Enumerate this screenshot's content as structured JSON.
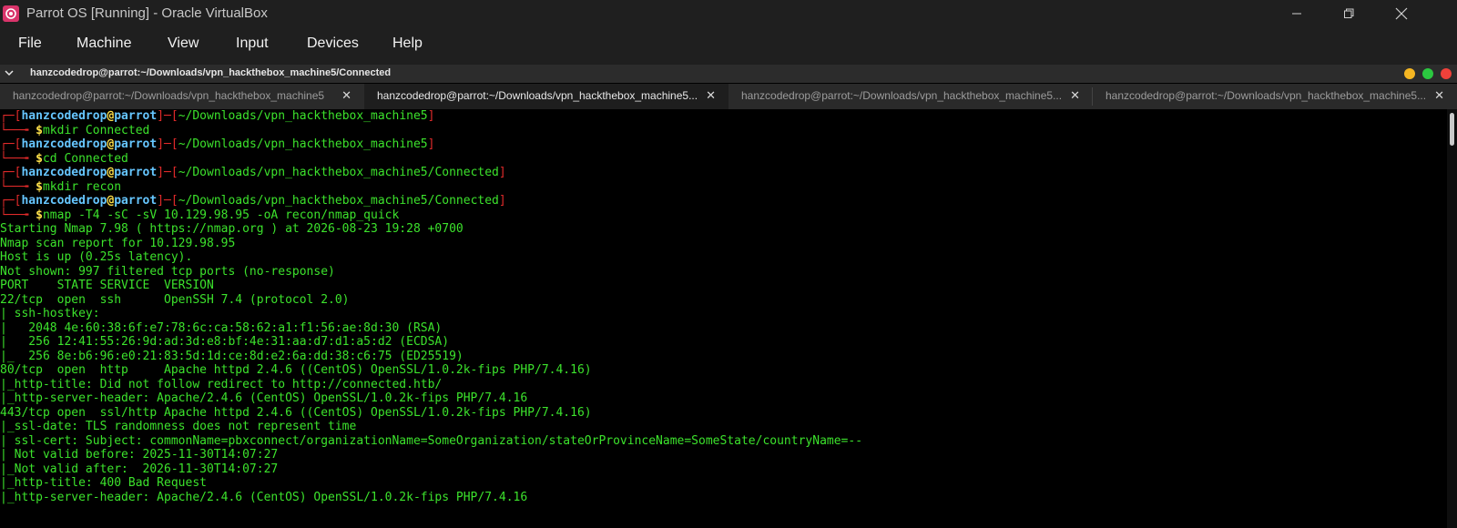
{
  "window": {
    "title": "Parrot OS [Running] - Oracle VirtualBox",
    "controls": [
      "minimize-icon",
      "restore-icon",
      "close-icon"
    ]
  },
  "menu": [
    "File",
    "Machine",
    "View",
    "Input",
    "Devices",
    "Help"
  ],
  "terminal_window": {
    "title": "hanzcodedrop@parrot:~/Downloads/vpn_hackthebox_machine5/Connected",
    "dot_colors": [
      "#f5b622",
      "#2bc840",
      "#f0413a"
    ]
  },
  "tabs": [
    {
      "label": "hanzcodedrop@parrot:~/Downloads/vpn_hackthebox_machine5",
      "active": false
    },
    {
      "label": "hanzcodedrop@parrot:~/Downloads/vpn_hackthebox_machine5...",
      "active": true
    },
    {
      "label": "hanzcodedrop@parrot:~/Downloads/vpn_hackthebox_machine5...",
      "active": false
    },
    {
      "label": "hanzcodedrop@parrot:~/Downloads/vpn_hackthebox_machine5...",
      "active": false
    }
  ],
  "prompt": {
    "user": "hanzcodedrop",
    "at": "@",
    "host": "parrot",
    "corner_top": "┌─[",
    "mid": "]─[",
    "close": "]",
    "corner_bottom": "└──╼ ",
    "dollar": "$"
  },
  "commands": [
    {
      "path": "~/Downloads/vpn_hackthebox_machine5",
      "cmd": "mkdir Connected"
    },
    {
      "path": "~/Downloads/vpn_hackthebox_machine5",
      "cmd": "cd Connected"
    },
    {
      "path": "~/Downloads/vpn_hackthebox_machine5/Connected",
      "cmd": "mkdir recon"
    },
    {
      "path": "~/Downloads/vpn_hackthebox_machine5/Connected",
      "cmd": "nmap -T4 -sC -sV 10.129.98.95 -oA recon/nmap_quick"
    }
  ],
  "output": [
    "Starting Nmap 7.98 ( https://nmap.org ) at 2026-08-23 19:28 +0700",
    "Nmap scan report for 10.129.98.95",
    "Host is up (0.25s latency).",
    "Not shown: 997 filtered tcp ports (no-response)",
    "PORT    STATE SERVICE  VERSION",
    "22/tcp  open  ssh      OpenSSH 7.4 (protocol 2.0)",
    "| ssh-hostkey:",
    "|   2048 4e:60:38:6f:e7:78:6c:ca:58:62:a1:f1:56:ae:8d:30 (RSA)",
    "|   256 12:41:55:26:9d:ad:3d:e8:bf:4e:31:aa:d7:d1:a5:d2 (ECDSA)",
    "|_  256 8e:b6:96:e0:21:83:5d:1d:ce:8d:e2:6a:dd:38:c6:75 (ED25519)",
    "80/tcp  open  http     Apache httpd 2.4.6 ((CentOS) OpenSSL/1.0.2k-fips PHP/7.4.16)",
    "|_http-title: Did not follow redirect to http://connected.htb/",
    "|_http-server-header: Apache/2.4.6 (CentOS) OpenSSL/1.0.2k-fips PHP/7.4.16",
    "443/tcp open  ssl/http Apache httpd 2.4.6 ((CentOS) OpenSSL/1.0.2k-fips PHP/7.4.16)",
    "|_ssl-date: TLS randomness does not represent time",
    "| ssl-cert: Subject: commonName=pbxconnect/organizationName=SomeOrganization/stateOrProvinceName=SomeState/countryName=--",
    "| Not valid before: 2025-11-30T14:07:27",
    "|_Not valid after:  2026-11-30T14:07:27",
    "|_http-title: 400 Bad Request",
    "|_http-server-header: Apache/2.4.6 (CentOS) OpenSSL/1.0.2k-fips PHP/7.4.16"
  ]
}
